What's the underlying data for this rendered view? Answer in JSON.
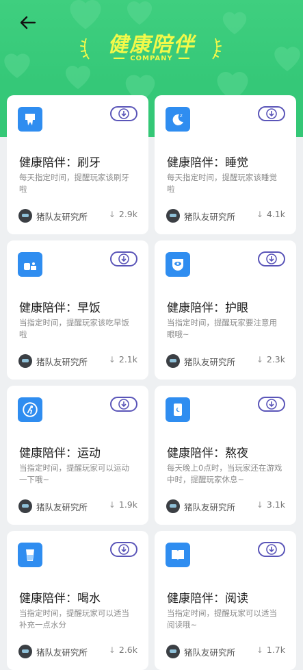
{
  "header": {
    "title": "健康陪伴",
    "subtitle": "COMPANY",
    "back_icon": "arrow-left-icon",
    "accent_color": "#f2f94a",
    "background_color": "#35c878"
  },
  "cards": [
    {
      "title": "健康陪伴：刷牙",
      "desc": "每天指定时间，提醒玩家该刷牙啦",
      "author": "猪队友研究所",
      "downloads": "2.9k",
      "icon": "tooth-icon"
    },
    {
      "title": "健康陪伴：睡觉",
      "desc": "每天指定时间，提醒玩家该睡觉啦",
      "author": "猪队友研究所",
      "downloads": "4.1k",
      "icon": "moon-sleep-icon"
    },
    {
      "title": "健康陪伴：早饭",
      "desc": "当指定时间，提醒玩家该吃早饭啦",
      "author": "猪队友研究所",
      "downloads": "2.1k",
      "icon": "breakfast-icon"
    },
    {
      "title": "健康陪伴：护眼",
      "desc": "当指定时间，提醒玩家要注意用眼哦~",
      "author": "猪队友研究所",
      "downloads": "2.3k",
      "icon": "eye-shield-icon"
    },
    {
      "title": "健康陪伴：运动",
      "desc": "当指定时间，提醒玩家可以运动一下哦~",
      "author": "猪队友研究所",
      "downloads": "1.9k",
      "icon": "running-icon"
    },
    {
      "title": "健康陪伴：熬夜",
      "desc": "每天晚上0点时，当玩家还在游戏中时，提醒玩家休息~",
      "author": "猪队友研究所",
      "downloads": "3.1k",
      "icon": "phone-night-icon"
    },
    {
      "title": "健康陪伴：喝水",
      "desc": "当指定时间，提醒玩家可以适当补充一点水分",
      "author": "猪队友研究所",
      "downloads": "2.6k",
      "icon": "water-glass-icon"
    },
    {
      "title": "健康陪伴：阅读",
      "desc": "当指定时间，提醒玩家可以适当阅读哦~",
      "author": "猪队友研究所",
      "downloads": "1.7k",
      "icon": "book-icon"
    }
  ]
}
